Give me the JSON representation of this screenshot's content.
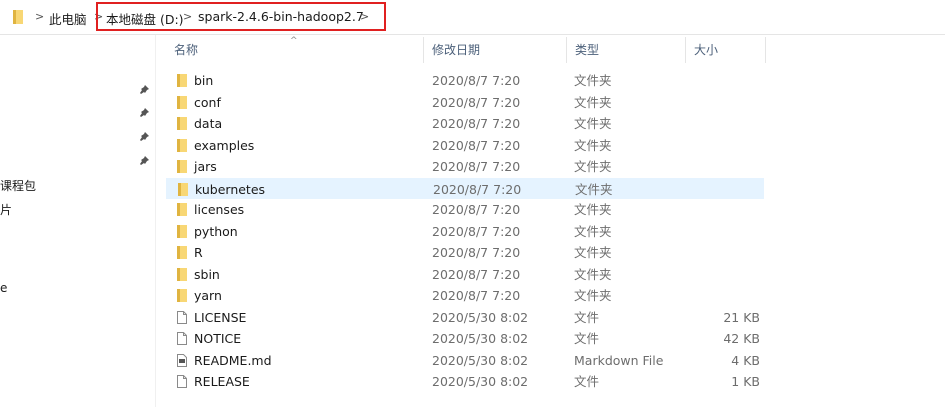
{
  "breadcrumb": {
    "segments": [
      "此电脑",
      "本地磁盘 (D:)",
      "spark-2.4.6-bin-hadoop2.7"
    ],
    "separator": ">"
  },
  "nav_pane": {
    "items": [
      "课程包",
      "片",
      "e"
    ]
  },
  "columns": {
    "name": "名称",
    "date": "修改日期",
    "type": "类型",
    "size": "大小"
  },
  "files": [
    {
      "name": "bin",
      "date": "2020/8/7 7:20",
      "type": "文件夹",
      "size": "",
      "icon": "folder-icon"
    },
    {
      "name": "conf",
      "date": "2020/8/7 7:20",
      "type": "文件夹",
      "size": "",
      "icon": "folder-icon"
    },
    {
      "name": "data",
      "date": "2020/8/7 7:20",
      "type": "文件夹",
      "size": "",
      "icon": "folder-icon"
    },
    {
      "name": "examples",
      "date": "2020/8/7 7:20",
      "type": "文件夹",
      "size": "",
      "icon": "folder-icon"
    },
    {
      "name": "jars",
      "date": "2020/8/7 7:20",
      "type": "文件夹",
      "size": "",
      "icon": "folder-icon"
    },
    {
      "name": "kubernetes",
      "date": "2020/8/7 7:20",
      "type": "文件夹",
      "size": "",
      "icon": "folder-icon",
      "selected": true
    },
    {
      "name": "licenses",
      "date": "2020/8/7 7:20",
      "type": "文件夹",
      "size": "",
      "icon": "folder-icon"
    },
    {
      "name": "python",
      "date": "2020/8/7 7:20",
      "type": "文件夹",
      "size": "",
      "icon": "folder-icon"
    },
    {
      "name": "R",
      "date": "2020/8/7 7:20",
      "type": "文件夹",
      "size": "",
      "icon": "folder-icon"
    },
    {
      "name": "sbin",
      "date": "2020/8/7 7:20",
      "type": "文件夹",
      "size": "",
      "icon": "folder-icon"
    },
    {
      "name": "yarn",
      "date": "2020/8/7 7:20",
      "type": "文件夹",
      "size": "",
      "icon": "folder-icon"
    },
    {
      "name": "LICENSE",
      "date": "2020/5/30 8:02",
      "type": "文件",
      "size": "21 KB",
      "icon": "file-icon"
    },
    {
      "name": "NOTICE",
      "date": "2020/5/30 8:02",
      "type": "文件",
      "size": "42 KB",
      "icon": "file-icon"
    },
    {
      "name": "README.md",
      "date": "2020/5/30 8:02",
      "type": "Markdown File",
      "size": "4 KB",
      "icon": "markdown-file-icon"
    },
    {
      "name": "RELEASE",
      "date": "2020/5/30 8:02",
      "type": "文件",
      "size": "1 KB",
      "icon": "file-icon"
    }
  ],
  "colors": {
    "selection": "#e5f3ff",
    "highlight_box": "#e02020",
    "folder": "#f8d775"
  }
}
